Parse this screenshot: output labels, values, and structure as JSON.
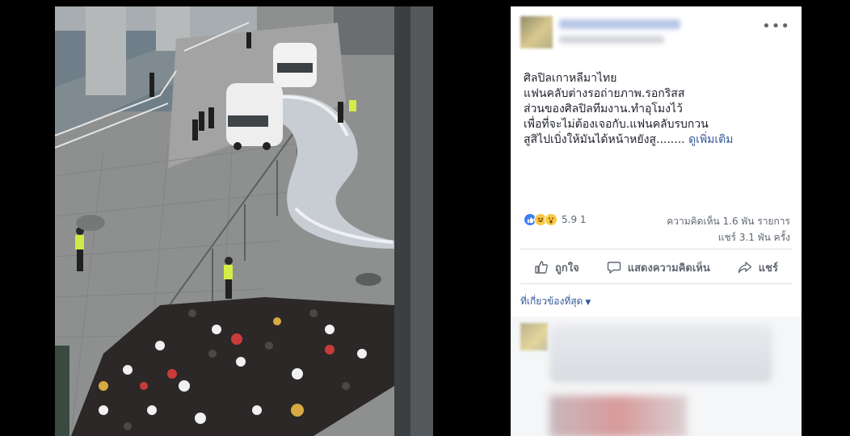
{
  "post": {
    "more_icon": "ellipsis-icon",
    "text_lines": [
      "ศิลปิลเกาหลีมาไทย",
      "แฟนคลับต่างรอถ่ายภาพ.รอกริสส",
      "ส่วนของศิลปิลทีมงาน.ทำอุโมงไว้",
      "เพื่อที่จะไม่ต้องเจอกับ.แฟนคลับรบกวน",
      "สูสิไปเบิ่งให้มันได้หน้าหยังสู........"
    ],
    "see_more": "ดูเพิ่มเติม"
  },
  "stats": {
    "reaction_icons": [
      "like-icon",
      "haha-icon",
      "wow-icon"
    ],
    "reaction_count": "5.9 ",
    "reaction_unit": "1",
    "comments": "ความคิดเห็น 1.6 พัน รายการ",
    "shares": "แชร์ 3.1 พัน ครั้ง"
  },
  "actions": {
    "like": "ถูกใจ",
    "comment": "แสดงความคิดเห็น",
    "share": "แชร์"
  },
  "comments": {
    "sort_label": "ที่เกี่ยวข้องที่สุด",
    "sort_icon": "caret-down-icon"
  },
  "colors": {
    "link": "#365899",
    "text": "#1d2129",
    "muted": "#606770",
    "like_blue": "#3b7ff4",
    "emoji_yellow": "#f7c844"
  }
}
